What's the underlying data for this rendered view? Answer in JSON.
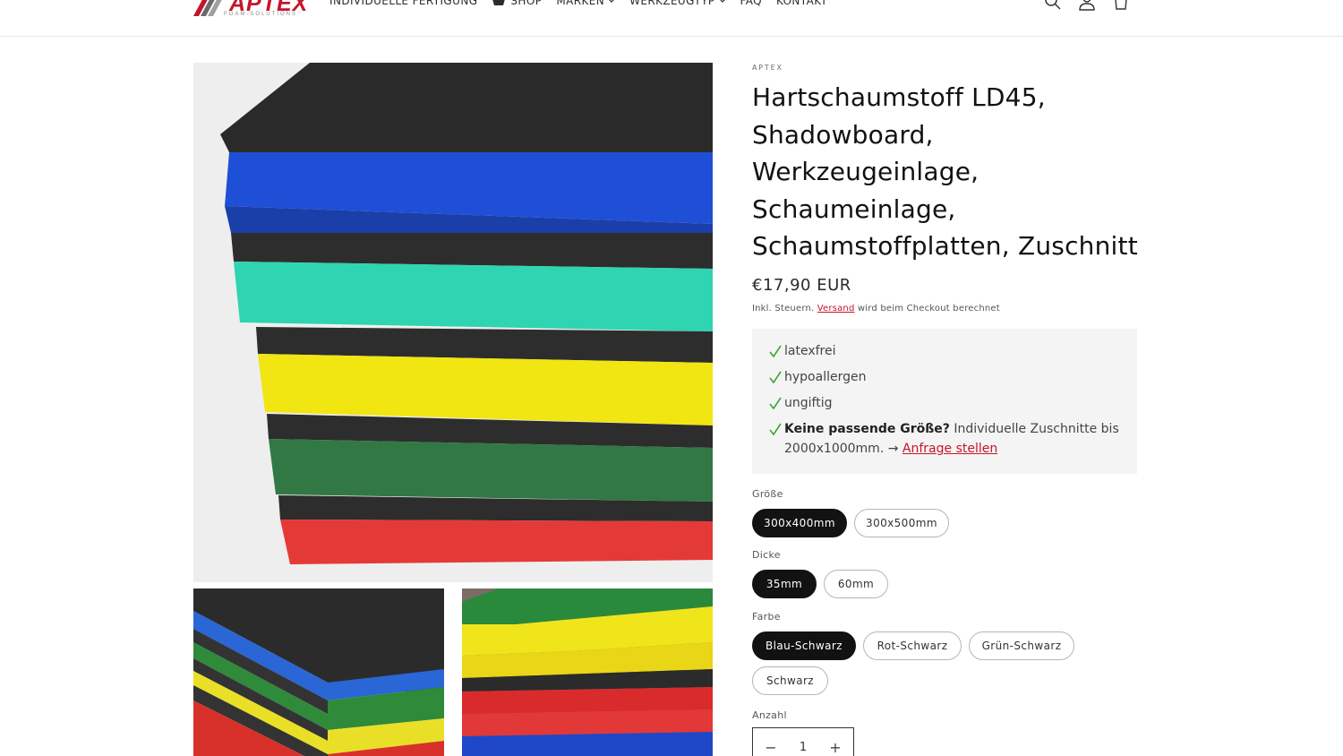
{
  "header": {
    "logo_text": "APTEX",
    "logo_subtitle": "FOAM-SOLUTIONS",
    "nav": [
      {
        "label": "INDIVIDUELLE FERTIGUNG"
      },
      {
        "label": "SHOP"
      },
      {
        "label": "MARKEN"
      },
      {
        "label": "WERKZEUGTYP"
      },
      {
        "label": "FAQ"
      },
      {
        "label": "KONTAKT"
      }
    ],
    "icons": [
      "search-icon",
      "account-icon",
      "cart-icon"
    ]
  },
  "product": {
    "vendor": "APTEX",
    "title": "Hartschaumstoff LD45, Shadowboard, Werkzeugeinlage, Schaumeinlage, Schaumstoffplatten, Zuschnitt",
    "price": "€17,90 EUR",
    "tax_prefix": "Inkl. Steuern. ",
    "tax_link": "Versand",
    "tax_suffix": " wird beim Checkout berechnet",
    "features": [
      {
        "text": "latexfrei"
      },
      {
        "text": "hypoallergen"
      },
      {
        "text": "ungiftig"
      }
    ],
    "feature_custom": {
      "bold": "Keine passende Größe?",
      "text": " Individuelle Zuschnitte bis 2000x1000mm. → ",
      "link": "Anfrage stellen"
    },
    "options": {
      "size_label": "Größe",
      "size_values": [
        "300x400mm",
        "300x500mm"
      ],
      "thickness_label": "Dicke",
      "thickness_values": [
        "35mm",
        "60mm"
      ],
      "color_label": "Farbe",
      "color_values": [
        "Blau-Schwarz",
        "Rot-Schwarz",
        "Grün-Schwarz",
        "Schwarz"
      ]
    },
    "quantity_label": "Anzahl",
    "quantity": "1",
    "quantity_minus": "−",
    "quantity_plus": "+"
  },
  "colors": {
    "accent": "#c4162a",
    "selected_pill": "#121212",
    "check": "#3aa635"
  }
}
